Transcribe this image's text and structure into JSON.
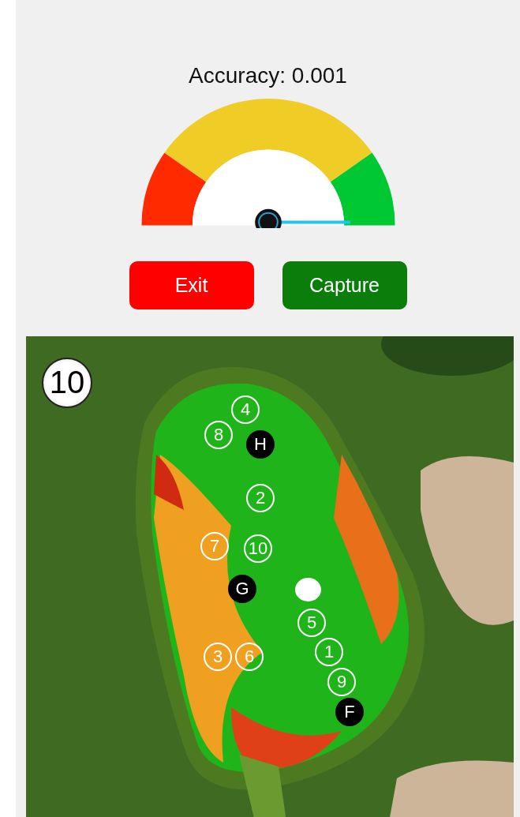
{
  "accuracy": {
    "label": "Accuracy: 0.001"
  },
  "buttons": [
    {
      "kind": "exit",
      "label": "Exit"
    },
    {
      "kind": "capture",
      "label": "Capture"
    }
  ],
  "map": {
    "kind": "picture",
    "hole_number": "10",
    "markers": [
      {
        "kind": "shot",
        "label": "8"
      },
      {
        "kind": "shot",
        "label": "4"
      },
      {
        "kind": "pin",
        "label": "H"
      },
      {
        "kind": "shot",
        "label": "2"
      },
      {
        "kind": "shot",
        "label": "7"
      },
      {
        "kind": "shot",
        "label": "10"
      },
      {
        "kind": "pin",
        "label": "G"
      },
      {
        "kind": "shot",
        "label": "5"
      },
      {
        "kind": "shot",
        "label": "1"
      },
      {
        "kind": "shot",
        "label": "9"
      },
      {
        "kind": "pin",
        "label": "F"
      },
      {
        "kind": "shot",
        "label": "3"
      },
      {
        "kind": "shot",
        "label": "6"
      }
    ]
  }
}
